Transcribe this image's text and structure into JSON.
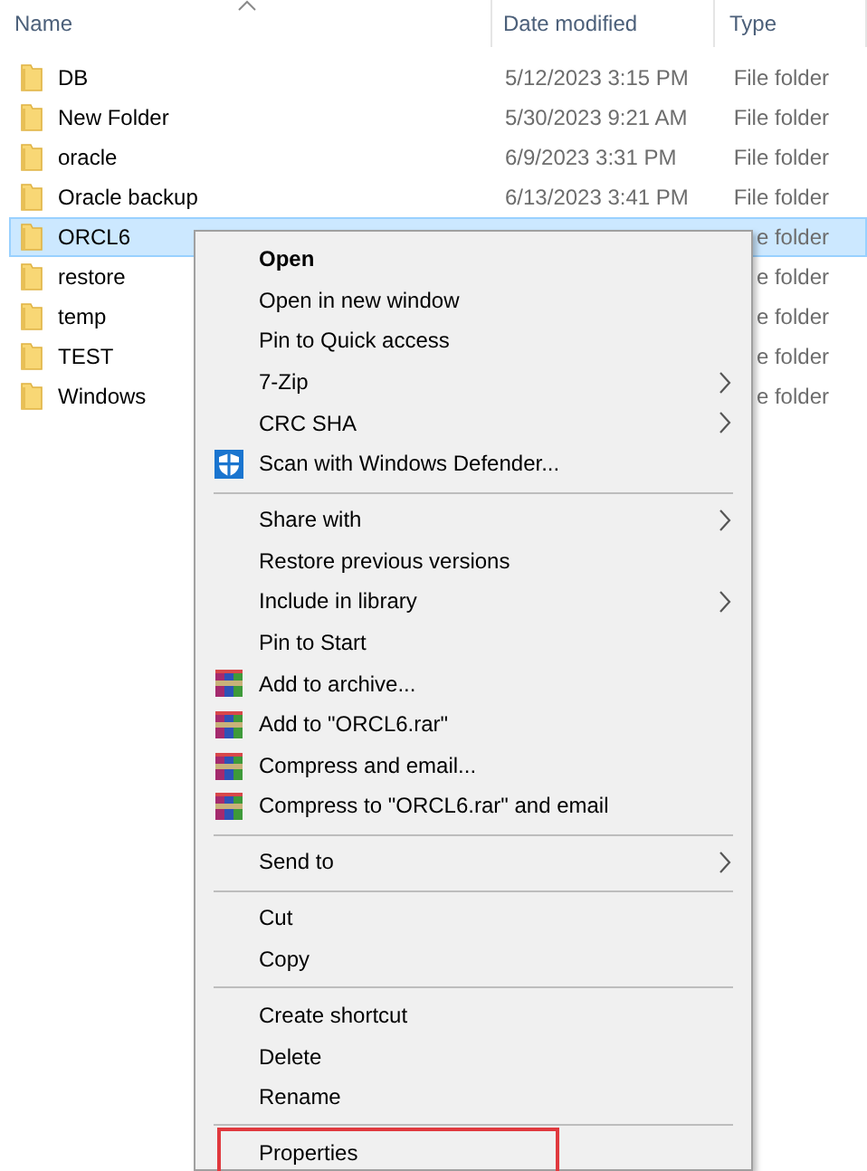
{
  "columns": [
    {
      "label": "Name",
      "sorted": true
    },
    {
      "label": "Date modified",
      "sorted": false
    },
    {
      "label": "Type",
      "sorted": false
    }
  ],
  "rows": [
    {
      "name": "DB",
      "date": "5/12/2023 3:15 PM",
      "type": "File folder",
      "selected": false
    },
    {
      "name": "New Folder",
      "date": "5/30/2023 9:21 AM",
      "type": "File folder",
      "selected": false
    },
    {
      "name": "oracle",
      "date": "6/9/2023 3:31 PM",
      "type": "File folder",
      "selected": false
    },
    {
      "name": "Oracle backup",
      "date": "6/13/2023 3:41 PM",
      "type": "File folder",
      "selected": false
    },
    {
      "name": "ORCL6",
      "type": "e folder",
      "selected": true
    },
    {
      "name": "restore",
      "type": "e folder",
      "selected": false
    },
    {
      "name": "temp",
      "type": "e folder",
      "selected": false
    },
    {
      "name": "TEST",
      "type": "e folder",
      "selected": false
    },
    {
      "name": "Windows",
      "type": "e folder",
      "selected": false
    }
  ],
  "context_menu": {
    "items": [
      {
        "kind": "command",
        "label": "Open",
        "default": true,
        "submenu": false,
        "marked": false
      },
      {
        "kind": "command",
        "label": "Open in new window",
        "default": false,
        "submenu": false,
        "marked": false
      },
      {
        "kind": "command",
        "label": "Pin to Quick access",
        "default": false,
        "submenu": false,
        "marked": false
      },
      {
        "kind": "command",
        "label": "7-Zip",
        "default": false,
        "submenu": true,
        "marked": false
      },
      {
        "kind": "command",
        "label": "CRC SHA",
        "default": false,
        "submenu": true,
        "marked": false
      },
      {
        "kind": "scan",
        "label": "Scan with Windows Defender...",
        "default": false,
        "submenu": false,
        "marked": false
      },
      {
        "kind": "separator"
      },
      {
        "kind": "command",
        "label": "Share with",
        "default": false,
        "submenu": true,
        "marked": false
      },
      {
        "kind": "command",
        "label": "Restore previous versions",
        "default": false,
        "submenu": false,
        "marked": false
      },
      {
        "kind": "command",
        "label": "Include in library",
        "default": false,
        "submenu": true,
        "marked": false
      },
      {
        "kind": "command",
        "label": "Pin to Start",
        "default": false,
        "submenu": false,
        "marked": false
      },
      {
        "kind": "archive",
        "label": "Add to archive...",
        "default": false,
        "submenu": false,
        "marked": false
      },
      {
        "kind": "archive",
        "label": "Add to \"ORCL6.rar\"",
        "default": false,
        "submenu": false,
        "marked": false
      },
      {
        "kind": "archive",
        "label": "Compress and email...",
        "default": false,
        "submenu": false,
        "marked": false
      },
      {
        "kind": "archive",
        "label": "Compress to \"ORCL6.rar\" and email",
        "default": false,
        "submenu": false,
        "marked": false
      },
      {
        "kind": "separator"
      },
      {
        "kind": "command",
        "label": "Send to",
        "default": false,
        "submenu": true,
        "marked": false
      },
      {
        "kind": "separator"
      },
      {
        "kind": "command",
        "label": "Cut",
        "default": false,
        "submenu": false,
        "marked": false
      },
      {
        "kind": "command",
        "label": "Copy",
        "default": false,
        "submenu": false,
        "marked": false
      },
      {
        "kind": "separator"
      },
      {
        "kind": "command",
        "label": "Create shortcut",
        "default": false,
        "submenu": false,
        "marked": false
      },
      {
        "kind": "command",
        "label": "Delete",
        "default": false,
        "submenu": false,
        "marked": false
      },
      {
        "kind": "command",
        "label": "Rename",
        "default": false,
        "submenu": false,
        "marked": false
      },
      {
        "kind": "separator"
      },
      {
        "kind": "command",
        "label": "Properties",
        "default": false,
        "submenu": false,
        "marked": true
      }
    ]
  }
}
